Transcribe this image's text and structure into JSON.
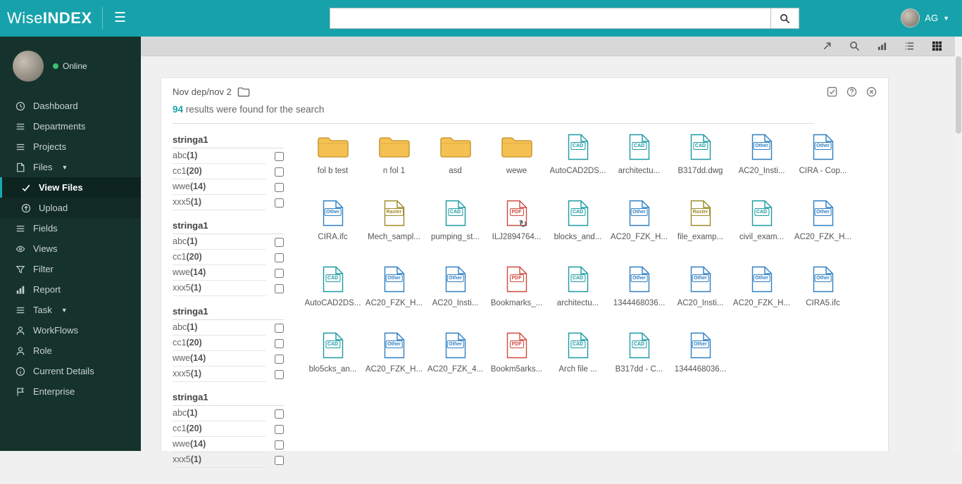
{
  "topbar": {
    "logo_normal": "Wise",
    "logo_bold": "INDEX",
    "search_value": "",
    "search_placeholder": "",
    "user_initials": "AG",
    "icons": [
      "hamburger-icon",
      "search-icon",
      "avatar",
      "caret-down-icon"
    ]
  },
  "sidebar": {
    "status": "Online",
    "items": [
      {
        "label": "Dashboard",
        "icon": "dashboard-clock-icon"
      },
      {
        "label": "Departments",
        "icon": "list-icon"
      },
      {
        "label": "Projects",
        "icon": "list-icon"
      },
      {
        "label": "Files",
        "icon": "file-icon",
        "expanded": true
      },
      {
        "label": "View Files",
        "icon": "check-icon",
        "active": true
      },
      {
        "label": "Upload",
        "icon": "upload-circle-icon"
      },
      {
        "label": "Fields",
        "icon": "list-icon"
      },
      {
        "label": "Views",
        "icon": "eye-icon"
      },
      {
        "label": "Filter",
        "icon": "funnel-icon"
      },
      {
        "label": "Report",
        "icon": "bar-chart-icon"
      },
      {
        "label": "Task",
        "icon": "list-icon",
        "expanded": false
      },
      {
        "label": "WorkFlows",
        "icon": "person-icon"
      },
      {
        "label": "Role",
        "icon": "person-icon"
      },
      {
        "label": "Current Details",
        "icon": "info-icon"
      },
      {
        "label": "Enterprise",
        "icon": "flag-icon"
      }
    ]
  },
  "content_toolbar": {
    "icons": [
      "expand-icon",
      "search-icon",
      "chart-icon",
      "list-view-icon",
      "grid-view-icon"
    ],
    "active_view": "grid"
  },
  "card": {
    "breadcrumb": "Nov dep/nov 2",
    "breadcrumb_icon": "folder-add-icon",
    "header_icons": [
      "select-check-icon",
      "help-icon",
      "close-icon"
    ],
    "results_count": "94",
    "results_suffix": " results were found for the search"
  },
  "filters": {
    "groups": [
      {
        "title": "stringa1",
        "options": [
          {
            "name": "abc",
            "count": "1"
          },
          {
            "name": "cc1",
            "count": "20"
          },
          {
            "name": "wwe",
            "count": "14"
          },
          {
            "name": "xxx5",
            "count": "1"
          }
        ]
      },
      {
        "title": "stringa1",
        "options": [
          {
            "name": "abc",
            "count": "1"
          },
          {
            "name": "cc1",
            "count": "20"
          },
          {
            "name": "wwe",
            "count": "14"
          },
          {
            "name": "xxx5",
            "count": "1"
          }
        ]
      },
      {
        "title": "stringa1",
        "options": [
          {
            "name": "abc",
            "count": "1"
          },
          {
            "name": "cc1",
            "count": "20"
          },
          {
            "name": "wwe",
            "count": "14"
          },
          {
            "name": "xxx5",
            "count": "1"
          }
        ]
      },
      {
        "title": "stringa1",
        "options": [
          {
            "name": "abc",
            "count": "1"
          },
          {
            "name": "cc1",
            "count": "20"
          },
          {
            "name": "wwe",
            "count": "14"
          },
          {
            "name": "xxx5",
            "count": "1"
          }
        ]
      }
    ]
  },
  "colors": {
    "accent": "#17a2ab",
    "cad": "#1b9aa3",
    "other": "#2e7fc2",
    "raster": "#9c8b26",
    "pdf": "#cf4a3f",
    "folder_fill": "#f5c153",
    "folder_stroke": "#cc9c35"
  },
  "files": {
    "items": [
      {
        "type": "folder",
        "name": "fol b test"
      },
      {
        "type": "folder",
        "name": "n fol 1"
      },
      {
        "type": "folder",
        "name": "asd"
      },
      {
        "type": "folder",
        "name": "wewe"
      },
      {
        "type": "cad",
        "badge": "CAD",
        "name": "AutoCAD2DS..."
      },
      {
        "type": "cad",
        "badge": "CAD",
        "name": "architectu..."
      },
      {
        "type": "cad",
        "badge": "CAD",
        "name": "B317dd.dwg"
      },
      {
        "type": "other",
        "badge": "Other",
        "name": "AC20_Insti..."
      },
      {
        "type": "other",
        "badge": "Other",
        "name": "CIRA - Cop..."
      },
      {
        "type": "other",
        "badge": "Other",
        "name": "CIRA.ifc"
      },
      {
        "type": "raster",
        "badge": "Raster",
        "name": "Mech_sampl..."
      },
      {
        "type": "cad",
        "badge": "CAD",
        "name": "pumping_st..."
      },
      {
        "type": "pdf",
        "badge": "PDF",
        "name": "ILJ2894764...",
        "loading": true
      },
      {
        "type": "cad",
        "badge": "CAD",
        "name": "blocks_and..."
      },
      {
        "type": "other",
        "badge": "Other",
        "name": "AC20_FZK_H..."
      },
      {
        "type": "raster",
        "badge": "Raster",
        "name": "file_examp..."
      },
      {
        "type": "cad",
        "badge": "CAD",
        "name": "civil_exam..."
      },
      {
        "type": "other",
        "badge": "Other",
        "name": "AC20_FZK_H..."
      },
      {
        "type": "cad",
        "badge": "CAD",
        "name": "AutoCAD2DS..."
      },
      {
        "type": "other",
        "badge": "Other",
        "name": "AC20_FZK_H..."
      },
      {
        "type": "other",
        "badge": "Other",
        "name": "AC20_Insti..."
      },
      {
        "type": "pdf",
        "badge": "PDF",
        "name": "Bookmarks_..."
      },
      {
        "type": "cad",
        "badge": "CAD",
        "name": "architectu..."
      },
      {
        "type": "other",
        "badge": "Other",
        "name": "1344468036..."
      },
      {
        "type": "other",
        "badge": "Other",
        "name": "AC20_Insti..."
      },
      {
        "type": "other",
        "badge": "Other",
        "name": "AC20_FZK_H..."
      },
      {
        "type": "other",
        "badge": "Other",
        "name": "CIRA5.ifc"
      },
      {
        "type": "cad",
        "badge": "CAD",
        "name": "blo5cks_an..."
      },
      {
        "type": "other",
        "badge": "Other",
        "name": "AC20_FZK_H..."
      },
      {
        "type": "other",
        "badge": "Other",
        "name": "AC20_FZK_4..."
      },
      {
        "type": "pdf",
        "badge": "PDF",
        "name": "Bookm5arks..."
      },
      {
        "type": "cad",
        "badge": "CAD",
        "name": "Arch file ..."
      },
      {
        "type": "cad",
        "badge": "CAD",
        "name": "B317dd - C..."
      },
      {
        "type": "other",
        "badge": "Other",
        "name": "1344468036..."
      }
    ]
  }
}
